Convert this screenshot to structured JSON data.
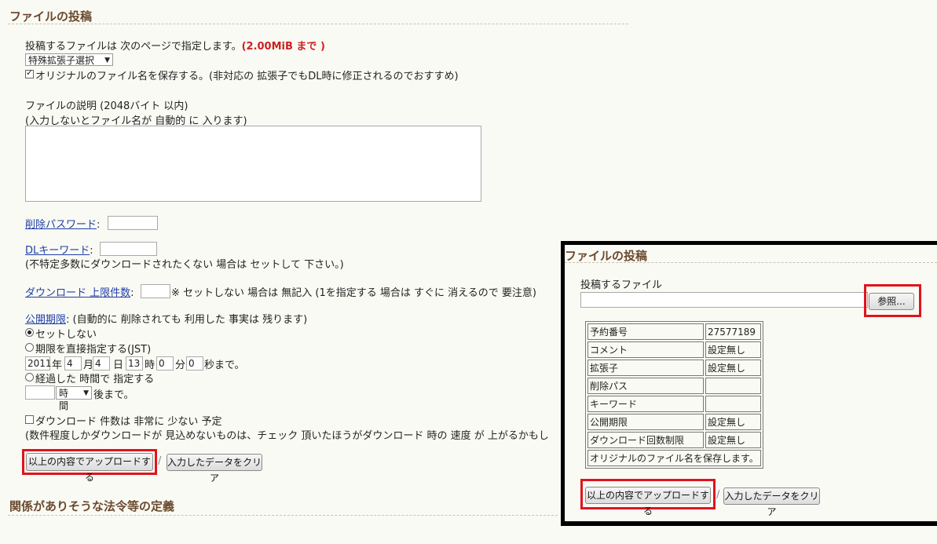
{
  "main": {
    "title": "ファイルの投稿",
    "intro": "投稿するファイルは 次のページで指定します。",
    "max_size": "(2.00MiB まで )",
    "ext_select": "特殊拡張子選択",
    "keep_name_label": "オリジナルのファイル名を保存する。(非対応の 拡張子でもDL時に修正されるのでおすすめ)",
    "desc_label1": "ファイルの説明 (2048バイト 以内)",
    "desc_label2": "(入力しないとファイル名が 自動的 に 入ります)",
    "delete_pass_link": "削除パスワード",
    "colon": ":",
    "dl_keyword_link": "DLキーワード",
    "dl_keyword_note": "(不特定多数にダウンロードされたくない 場合は セットして 下さい。)",
    "dl_limit_link": "ダウンロード 上限件数",
    "dl_limit_note": "※ セットしない 場合は 無記入 (1を指定する 場合は すぐに 消えるので 要注意)",
    "expire_link": "公開期限",
    "expire_note": ": (自動的に 削除されても 利用した 事実は 残ります)",
    "opt_none": "セットしない",
    "opt_direct": "期限を直接指定する(JST)",
    "year": "2011",
    "year_unit": "年",
    "month": "4",
    "month_unit": "月",
    "day": "4",
    "day_unit": "日",
    "hour": "13",
    "hour_unit": "時",
    "minute": "0",
    "minute_unit": "分",
    "second": "0",
    "second_unit": "秒まで。",
    "opt_elapsed": "経過した 時間で 指定する",
    "elapsed_unit": "時間",
    "elapsed_suffix": "後まで。",
    "few_dl_label": "ダウンロード 件数は 非常に 少ない 予定",
    "few_dl_note": "(数件程度しかダウンロードが 見込めないものは、チェック 頂いたほうがダウンロード 時の 速度 が 上がるかもし",
    "upload_button": "以上の内容でアップロードする",
    "separator": "/",
    "clear_button": "入力したデータをクリア",
    "related_title": "関係がありそうな法令等の定義"
  },
  "panel": {
    "title": "ファイルの投稿",
    "file_label": "投稿するファイル",
    "browse_button": "参照...",
    "rows": [
      {
        "label": "予約番号",
        "value": "27577189"
      },
      {
        "label": "コメント",
        "value": "設定無し"
      },
      {
        "label": "拡張子",
        "value": "設定無し"
      },
      {
        "label": "削除パス",
        "value": ""
      },
      {
        "label": "キーワード",
        "value": ""
      },
      {
        "label": "公開期限",
        "value": "設定無し"
      },
      {
        "label": "ダウンロード回数制限",
        "value": "設定無し"
      }
    ],
    "keep_name_row": "オリジナルのファイル名を保存します。",
    "upload_button": "以上の内容でアップロードする",
    "separator": "/",
    "clear_button": "入力したデータをクリア"
  }
}
